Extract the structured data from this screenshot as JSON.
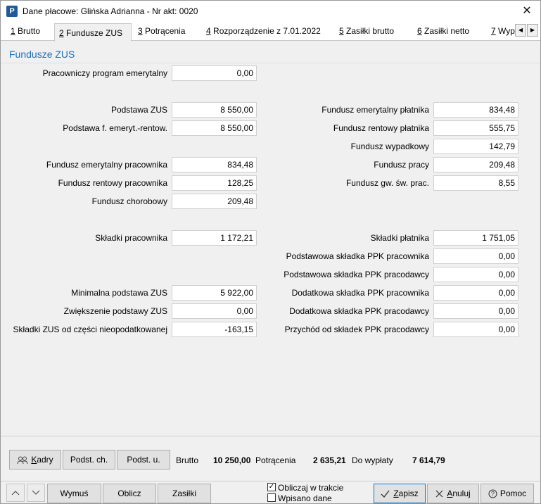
{
  "window": {
    "title": "Dane płacowe: Glińska Adrianna - Nr akt: 0020",
    "app_icon": "P",
    "close_glyph": "✕"
  },
  "tabs": [
    {
      "key": "1",
      "label": " Brutto"
    },
    {
      "key": "2",
      "label": " Fundusze ZUS"
    },
    {
      "key": "3",
      "label": " Potrącenia"
    },
    {
      "key": "4",
      "label": " Rozporządzenie z 7.01.2022"
    },
    {
      "key": "5",
      "label": " Zasiłki brutto"
    },
    {
      "key": "6",
      "label": " Zasiłki netto"
    },
    {
      "key": "7",
      "label": " Wyp"
    }
  ],
  "section_title": "Fundusze ZUS",
  "left_fields": {
    "ppe": {
      "label": "Pracowniczy program emerytalny",
      "value": "0,00"
    },
    "podstawa_zus": {
      "label": "Podstawa ZUS",
      "value": "8 550,00"
    },
    "podstawa_er": {
      "label": "Podstawa f. emeryt.-rentow.",
      "value": "8 550,00"
    },
    "fem_prac": {
      "label": "Fundusz emerytalny pracownika",
      "value": "834,48"
    },
    "fren_prac": {
      "label": "Fundusz rentowy pracownika",
      "value": "128,25"
    },
    "fchor": {
      "label": "Fundusz chorobowy",
      "value": "209,48"
    },
    "skl_prac": {
      "label": "Składki pracownika",
      "value": "1 172,21"
    },
    "min_podst": {
      "label": "Minimalna podstawa ZUS",
      "value": "5 922,00"
    },
    "zwiek": {
      "label": "Zwiększenie podstawy ZUS",
      "value": "0,00"
    },
    "skl_nieopod": {
      "label": "Składki ZUS od części nieopodatkowanej",
      "value": "-163,15"
    }
  },
  "right_fields": {
    "fem_plat": {
      "label": "Fundusz emerytalny płatnika",
      "value": "834,48"
    },
    "fren_plat": {
      "label": "Fundusz rentowy płatnika",
      "value": "555,75"
    },
    "fwyp": {
      "label": "Fundusz wypadkowy",
      "value": "142,79"
    },
    "fpracy": {
      "label": "Fundusz pracy",
      "value": "209,48"
    },
    "fgsp": {
      "label": "Fundusz gw. św. prac.",
      "value": "8,55"
    },
    "skl_plat": {
      "label": "Składki płatnika",
      "value": "1 751,05"
    },
    "ppk_pods_prac": {
      "label": "Podstawowa składka PPK pracownika",
      "value": "0,00"
    },
    "ppk_pods_pracod": {
      "label": "Podstawowa składka PPK pracodawcy",
      "value": "0,00"
    },
    "ppk_dod_prac": {
      "label": "Dodatkowa składka PPK pracownika",
      "value": "0,00"
    },
    "ppk_dod_pracod": {
      "label": "Dodatkowa składka PPK pracodawcy",
      "value": "0,00"
    },
    "ppk_przychod": {
      "label": "Przychód od składek PPK pracodawcy",
      "value": "0,00"
    }
  },
  "summary": {
    "kadry_label_ul": "K",
    "kadry_label_rest": "adry",
    "podst_ch": "Podst. ch.",
    "podst_u": "Podst. u.",
    "brutto_label": "Brutto",
    "brutto_value": "10 250,00",
    "potracenia_label": "Potrącenia",
    "potracenia_value": "2 635,21",
    "do_wyplaty_label": "Do wypłaty",
    "do_wyplaty_value": "7 614,79"
  },
  "footer": {
    "wymus": "Wymuś",
    "oblicz": "Oblicz",
    "zasilki": "Zasiłki",
    "oblicz_w_trakcie": "Obliczaj w trakcie",
    "oblicz_w_trakcie_checked": true,
    "wpisano_dane": "Wpisano dane",
    "wpisano_dane_checked": false,
    "zapisz_ul": "Z",
    "zapisz_rest": "apisz",
    "anuluj_ul": "A",
    "anuluj_rest": "nuluj",
    "pomoc": "Pomoc"
  }
}
